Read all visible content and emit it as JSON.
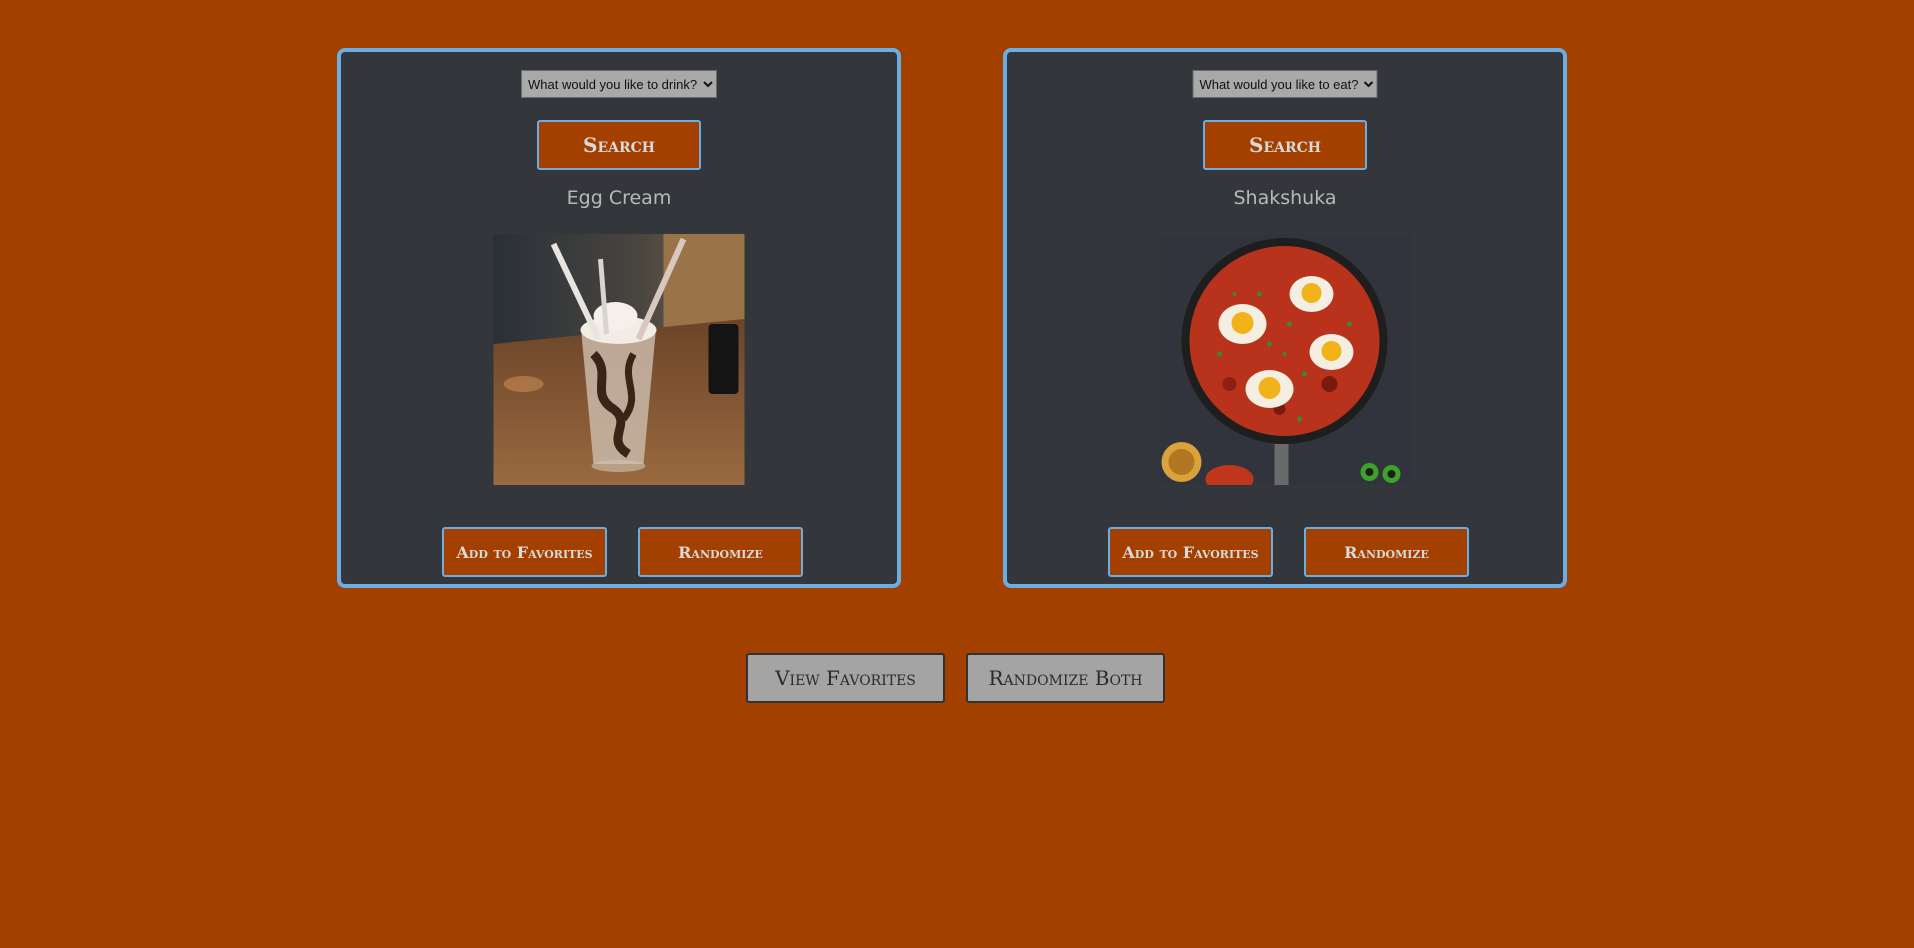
{
  "drink_card": {
    "select": {
      "selected": "What would you like to drink?",
      "options": [
        "What would you like to drink?"
      ]
    },
    "search_label": "Search",
    "recipe_name": "Egg Cream",
    "image_subject": "egg cream milkshake glass with straws and whipped cream",
    "add_favorites_label": "Add to Favorites",
    "randomize_label": "Randomize"
  },
  "food_card": {
    "select": {
      "selected": "What would you like to eat?",
      "options": [
        "What would you like to eat?"
      ]
    },
    "search_label": "Search",
    "recipe_name": "Shakshuka",
    "image_subject": "shakshuka skillet with eggs in tomato sauce",
    "add_favorites_label": "Add to Favorites",
    "randomize_label": "Randomize"
  },
  "footer": {
    "view_favorites_label": "View Favorites",
    "randomize_both_label": "Randomize Both"
  },
  "colors": {
    "page_background": "#a34000",
    "card_background": "#33373b",
    "card_border": "#6aaee4",
    "button_background": "#a34000",
    "footer_button_background": "#a4a4a4"
  }
}
